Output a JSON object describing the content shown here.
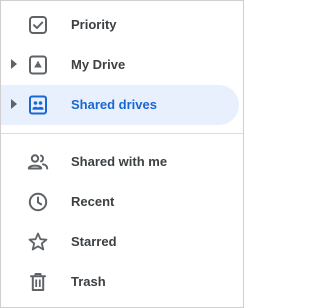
{
  "nav": {
    "items": [
      {
        "label": "Priority",
        "icon": "priority-icon"
      },
      {
        "label": "My Drive",
        "icon": "my-drive-icon"
      },
      {
        "label": "Shared drives",
        "icon": "shared-drives-icon",
        "selected": true
      },
      {
        "label": "Shared with me",
        "icon": "shared-with-me-icon"
      },
      {
        "label": "Recent",
        "icon": "recent-icon"
      },
      {
        "label": "Starred",
        "icon": "starred-icon"
      },
      {
        "label": "Trash",
        "icon": "trash-icon"
      }
    ]
  },
  "colors": {
    "text": "#3c4043",
    "icon": "#5f6368",
    "selected_bg": "#e8f0fe",
    "selected_text": "#1967d2",
    "divider": "#dadce0"
  }
}
